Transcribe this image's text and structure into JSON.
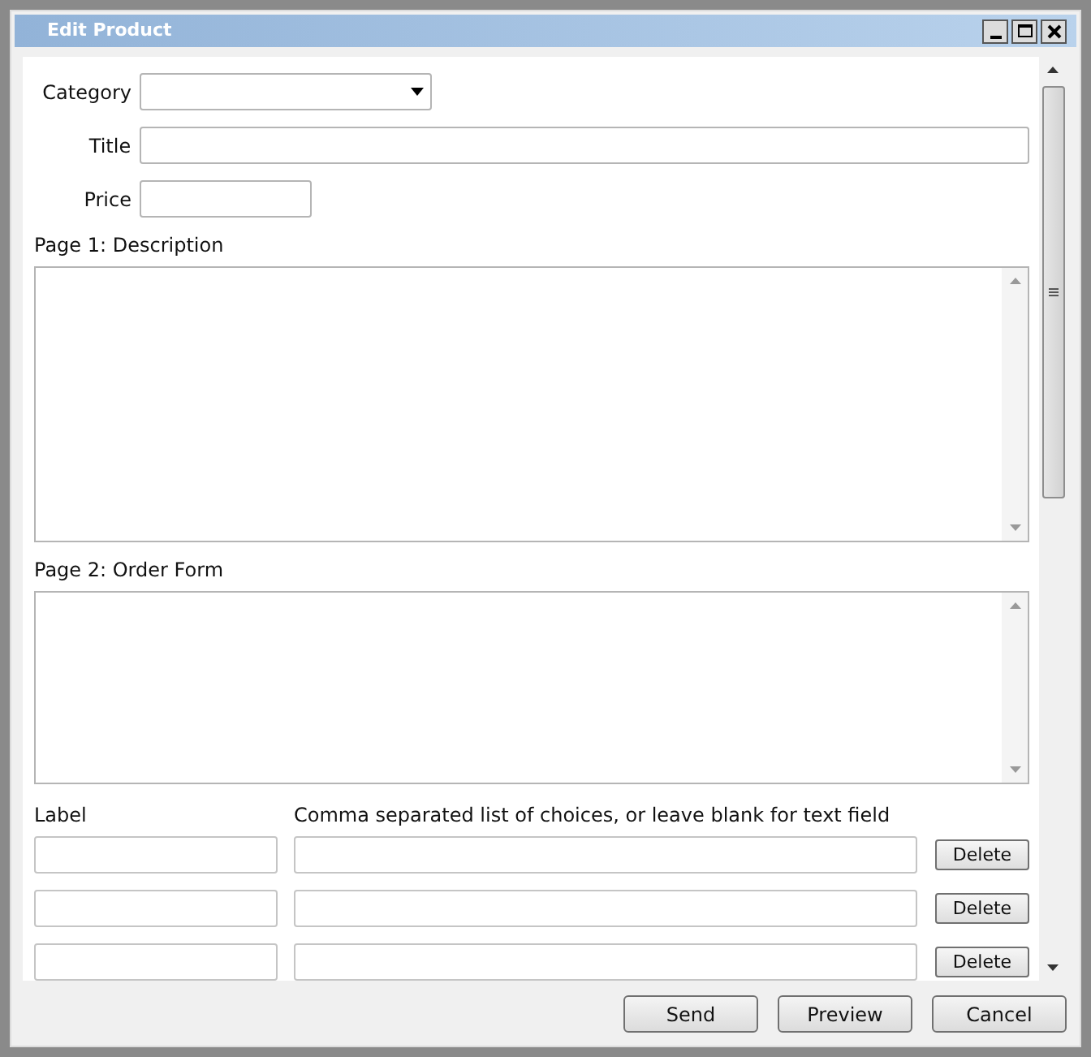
{
  "window": {
    "title": "Edit Product"
  },
  "fields": [
    {
      "label": "Category",
      "kind": "select"
    },
    {
      "label": "Title",
      "kind": "text"
    },
    {
      "label": "Price",
      "kind": "short"
    }
  ],
  "pages": [
    {
      "label": "Page 1: Description"
    },
    {
      "label": "Page 2: Order Form"
    }
  ],
  "choices": {
    "columns": [
      "Label",
      "Comma separated list of choices, or leave blank for text field"
    ],
    "rows": [
      {
        "delete": "Delete"
      },
      {
        "delete": "Delete"
      },
      {
        "delete": "Delete"
      }
    ]
  },
  "buttons": [
    "Send",
    "Preview",
    "Cancel"
  ]
}
